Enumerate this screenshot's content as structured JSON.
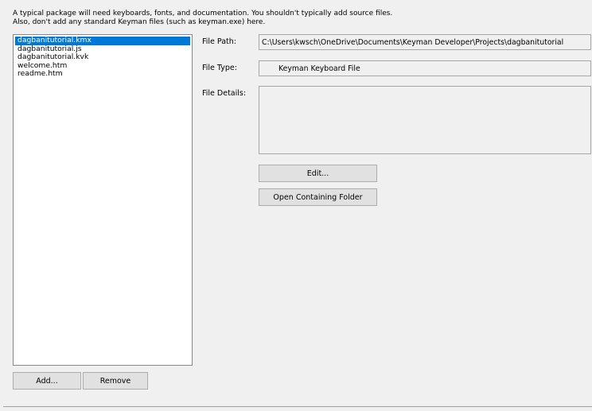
{
  "help": {
    "line1": "A typical package will need keyboards, fonts, and documentation. You shouldn't typically add source files.",
    "line2": "Also, don't add any standard Keyman files (such as keyman.exe) here."
  },
  "files": {
    "items": [
      {
        "name": "dagbanitutorial.kmx",
        "selected": true
      },
      {
        "name": "dagbanitutorial.js",
        "selected": false
      },
      {
        "name": "dagbanitutorial.kvk",
        "selected": false
      },
      {
        "name": "welcome.htm",
        "selected": false
      },
      {
        "name": "readme.htm",
        "selected": false
      }
    ],
    "selected_color": "#0078d7"
  },
  "buttons": {
    "add_label": "Add...",
    "remove_label": "Remove",
    "edit_label": "Edit...",
    "open_folder_label": "Open Containing Folder"
  },
  "details": {
    "path_label": "File Path:",
    "path_value": "C:\\Users\\kwsch\\OneDrive\\Documents\\Keyman Developer\\Projects\\dagbanitutorial",
    "type_label": "File Type:",
    "type_value": "Keyman Keyboard File",
    "details_label": "File Details:",
    "details_value": ""
  }
}
